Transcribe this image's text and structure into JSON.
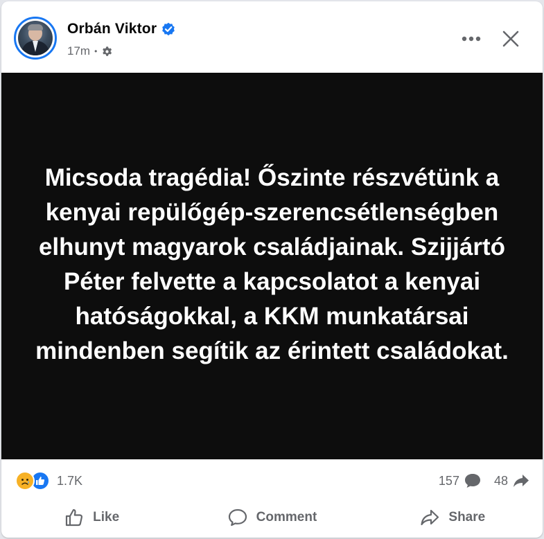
{
  "post": {
    "author": "Orbán Viktor",
    "timestamp": "17m",
    "privacy_icon": "gear-icon",
    "body_text": "Micsoda tragédia! Őszinte részvétünk a kenyai repülőgép-szerencsétlenségben elhunyt magyarok családjainak. Szijjártó Péter felvette a kapcsolatot a kenyai hatóságokkal, a KKM munkatársai mindenben segítik az érintett családokat.",
    "image_bg_color": "#0d0d0d",
    "verified_color": "#1877f2"
  },
  "stats": {
    "reactions_count": "1.7K",
    "reaction_icons": [
      "sad-reaction-icon",
      "like-reaction-icon"
    ],
    "comments_count": "157",
    "shares_count": "48"
  },
  "actions": {
    "like_label": "Like",
    "comment_label": "Comment",
    "share_label": "Share"
  },
  "colors": {
    "accent": "#1877f2",
    "muted_text": "#65676b",
    "sad_reaction": "#f7b125"
  }
}
